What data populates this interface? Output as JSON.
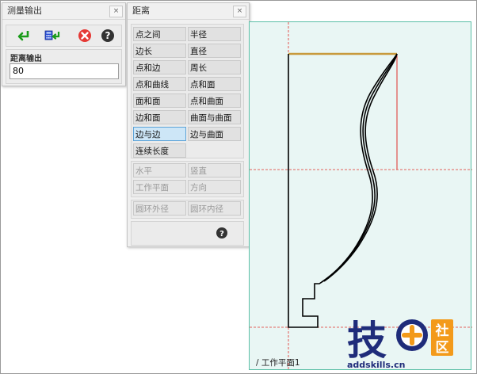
{
  "measure_panel": {
    "title": "测量输出",
    "close_label": "×",
    "toolbar": [
      {
        "name": "apply-arrow-icon",
        "color": "#1a9c1a"
      },
      {
        "name": "calculator-arrow-icon",
        "color": "#1a3fbf"
      },
      {
        "name": "cancel-icon",
        "color": "#e53935"
      },
      {
        "name": "help-icon",
        "color": "#333333"
      }
    ],
    "output_label": "距离输出",
    "output_value": "80"
  },
  "distance_panel": {
    "title": "距离",
    "close_label": "×",
    "options": [
      {
        "label": "点之间",
        "state": "normal"
      },
      {
        "label": "半径",
        "state": "normal"
      },
      {
        "label": "边长",
        "state": "normal"
      },
      {
        "label": "直径",
        "state": "normal"
      },
      {
        "label": "点和边",
        "state": "normal"
      },
      {
        "label": "周长",
        "state": "normal"
      },
      {
        "label": "点和曲线",
        "state": "normal"
      },
      {
        "label": "点和面",
        "state": "normal"
      },
      {
        "label": "面和面",
        "state": "normal"
      },
      {
        "label": "点和曲面",
        "state": "normal"
      },
      {
        "label": "边和面",
        "state": "normal"
      },
      {
        "label": "曲面与曲面",
        "state": "normal"
      },
      {
        "label": "边与边",
        "state": "selected"
      },
      {
        "label": "边与曲面",
        "state": "normal"
      },
      {
        "label": "连续长度",
        "state": "normal"
      }
    ],
    "direction_options": [
      {
        "label": "水平",
        "state": "disabled"
      },
      {
        "label": "竖直",
        "state": "disabled"
      },
      {
        "label": "工作平面",
        "state": "disabled"
      },
      {
        "label": "方向",
        "state": "disabled"
      }
    ],
    "ring_options": [
      {
        "label": "圆环外径",
        "state": "disabled"
      },
      {
        "label": "圆环内径",
        "state": "disabled"
      }
    ]
  },
  "viewport": {
    "workplane_label": "/ 工作平面1",
    "background": "#e9f6f4",
    "border_color": "#5bbfa6",
    "guide_color": "#e0302a",
    "dimension_color": "#c89a3c",
    "profile_color": "#000000"
  },
  "watermark": {
    "char_1": "技",
    "char_2_top": "社",
    "char_2_bottom": "区",
    "url": "addskills.cn",
    "blue": "#1f2c7a",
    "orange": "#f39a1a"
  }
}
